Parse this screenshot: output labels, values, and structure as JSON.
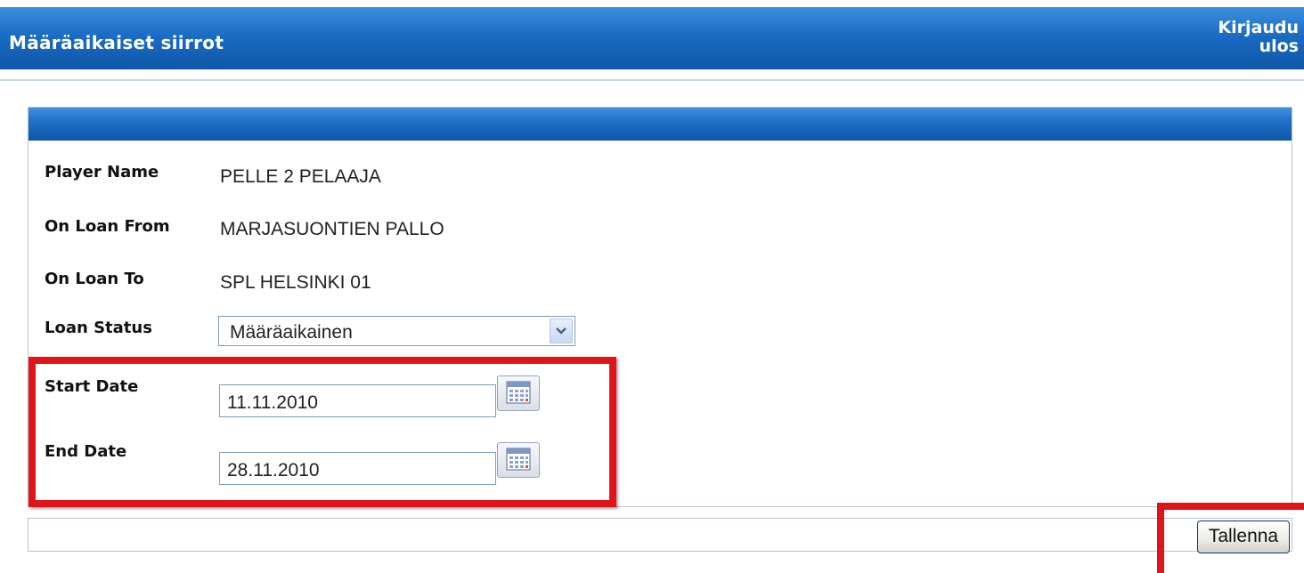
{
  "header": {
    "title": "Määräaikaiset siirrot",
    "logout_label": "Kirjaudu ulos"
  },
  "form": {
    "player_name_label": "Player Name",
    "player_name_value": "PELLE 2  PELAAJA",
    "loan_from_label": "On Loan From",
    "loan_from_value": "MARJASUONTIEN PALLO",
    "loan_to_label": "On Loan To",
    "loan_to_value": "SPL HELSINKI 01",
    "loan_status_label": "Loan Status",
    "loan_status_value": "Määräaikainen",
    "start_date_label": "Start Date",
    "start_date_value": "11.11.2010",
    "end_date_label": "End Date",
    "end_date_value": "28.11.2010"
  },
  "footer": {
    "save_label": "Tallenna"
  },
  "colors": {
    "header_blue": "#1a6cc4",
    "highlight_red": "#e0151c"
  },
  "icons": {
    "calendar": "calendar-icon",
    "dropdown": "chevron-down-icon"
  }
}
